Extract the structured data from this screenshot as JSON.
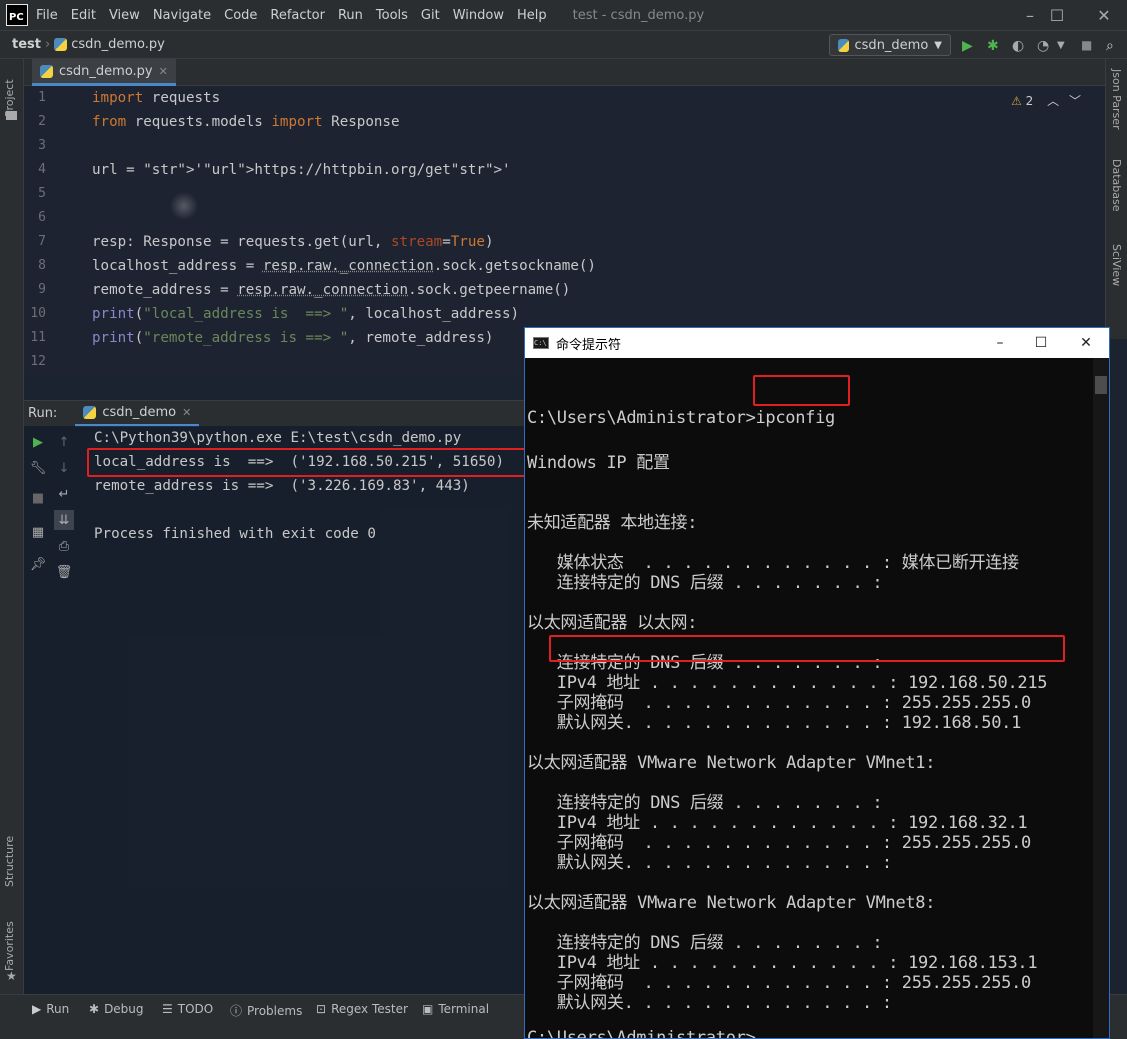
{
  "ide": {
    "logo": "PC",
    "menu": [
      "File",
      "Edit",
      "View",
      "Navigate",
      "Code",
      "Refactor",
      "Run",
      "Tools",
      "Git",
      "Window",
      "Help"
    ],
    "window_title": "test - csdn_demo.py",
    "breadcrumb": [
      "test",
      "csdn_demo.py"
    ],
    "run_config": "csdn_demo",
    "editor_tab": "csdn_demo.py",
    "warning_count": "2",
    "left_tools": [
      "Project",
      "Structure",
      "Favorites"
    ],
    "right_tools": [
      "Json Parser",
      "Database",
      "SciView"
    ],
    "code_lines": [
      {
        "n": "1",
        "text": "import requests"
      },
      {
        "n": "2",
        "text": "from requests.models import Response"
      },
      {
        "n": "3",
        "text": ""
      },
      {
        "n": "4",
        "text": "url = 'https://httpbin.org/get'"
      },
      {
        "n": "5",
        "text": ""
      },
      {
        "n": "6",
        "text": ""
      },
      {
        "n": "7",
        "text": "resp: Response = requests.get(url, stream=True)"
      },
      {
        "n": "8",
        "text": "localhost_address = resp.raw._connection.sock.getsockname()"
      },
      {
        "n": "9",
        "text": "remote_address = resp.raw._connection.sock.getpeername()"
      },
      {
        "n": "10",
        "text": "print(\"local_address is  ==> \", localhost_address)"
      },
      {
        "n": "11",
        "text": "print(\"remote_address is ==> \", remote_address)"
      },
      {
        "n": "12",
        "text": ""
      }
    ],
    "run_label": "Run:",
    "run_tab": "csdn_demo",
    "output": [
      "C:\\Python39\\python.exe E:\\test\\csdn_demo.py",
      "local_address is  ==>  ('192.168.50.215', 51650)",
      "remote_address is ==>  ('3.226.169.83', 443)",
      "",
      "Process finished with exit code 0"
    ],
    "bottom_tabs": [
      "Run",
      "Debug",
      "TODO",
      "Problems",
      "Regex Tester",
      "Terminal"
    ]
  },
  "cmd": {
    "title": "命令提示符",
    "lines": [
      "C:\\Users\\Administrator>ipconfig",
      "",
      "Windows IP 配置",
      "",
      "",
      "未知适配器 本地连接:",
      "",
      "   媒体状态  . . . . . . . . . . . . : 媒体已断开连接",
      "   连接特定的 DNS 后缀 . . . . . . . :",
      "",
      "以太网适配器 以太网:",
      "",
      "   连接特定的 DNS 后缀 . . . . . . . :",
      "   IPv4 地址 . . . . . . . . . . . . : 192.168.50.215",
      "   子网掩码  . . . . . . . . . . . . : 255.255.255.0",
      "   默认网关. . . . . . . . . . . . . : 192.168.50.1",
      "",
      "以太网适配器 VMware Network Adapter VMnet1:",
      "",
      "   连接特定的 DNS 后缀 . . . . . . . :",
      "   IPv4 地址 . . . . . . . . . . . . : 192.168.32.1",
      "   子网掩码  . . . . . . . . . . . . : 255.255.255.0",
      "   默认网关. . . . . . . . . . . . . :",
      "",
      "以太网适配器 VMware Network Adapter VMnet8:",
      "",
      "   连接特定的 DNS 后缀 . . . . . . . :",
      "   IPv4 地址 . . . . . . . . . . . . : 192.168.153.1",
      "   子网掩码  . . . . . . . . . . . . : 255.255.255.0",
      "   默认网关. . . . . . . . . . . . . :",
      "",
      "C:\\Users\\Administrator>"
    ]
  },
  "colors": {
    "accent": "#4a88c7",
    "highlight": "#e02020",
    "keyword": "#cc7832",
    "string": "#6a8759"
  }
}
